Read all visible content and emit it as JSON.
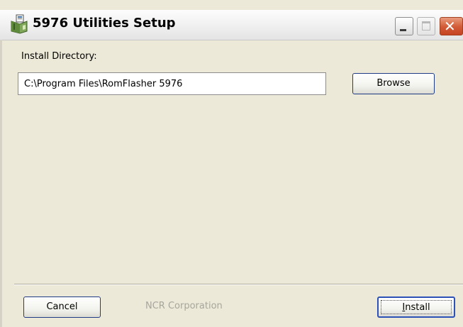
{
  "window": {
    "title": "5976 Utilities Setup",
    "icon": "setup-package-icon"
  },
  "install": {
    "directory_label": "Install Directory:",
    "directory_value": "C:\\Program Files\\RomFlasher 5976",
    "browse_label": "Browse"
  },
  "footer": {
    "cancel_label": "Cancel",
    "company_text": "NCR Corporation",
    "install_label": "Install",
    "install_mnemonic": "I"
  },
  "colors": {
    "window_bg": "#ece9d8",
    "button_border": "#1f3b84",
    "close_button": "#d25a36",
    "disabled_text": "#a7a69c"
  }
}
